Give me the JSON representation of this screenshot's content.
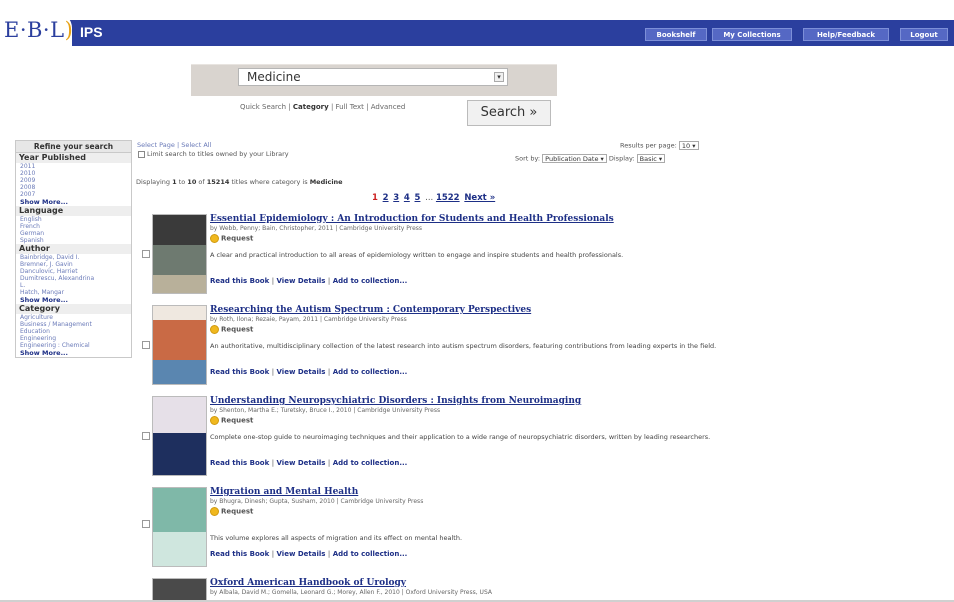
{
  "header": {
    "logo_text": "E·B·L",
    "product": "IPS",
    "nav": [
      {
        "label": "Bookshelf"
      },
      {
        "label": "My Collections"
      },
      {
        "label": "Help/Feedback"
      },
      {
        "label": "Logout"
      }
    ],
    "colors": {
      "bar": "#2b3f9e",
      "button": "#5568c4",
      "logo_accent": "#e8a317"
    }
  },
  "search": {
    "selected": "Medicine",
    "link_quick": "Quick Search",
    "link_category": "Category",
    "link_fulltext": "Full Text",
    "link_advanced": "Advanced",
    "sep": "|",
    "button": "Search »"
  },
  "sidebar": {
    "heading": "Refine your search",
    "year_title": "Year Published",
    "years": [
      "2011",
      "2010",
      "2009",
      "2008",
      "2007"
    ],
    "language_title": "Language",
    "languages": [
      "English",
      "French",
      "German",
      "Spanish"
    ],
    "author_title": "Author",
    "authors": [
      "Bainbridge, David I.",
      "Bremner, J. Gavin",
      "Danculovic, Harriet",
      "Dumitrescu, Alexandrina",
      "L.",
      "Hatch, Mangar"
    ],
    "category_title": "Category",
    "categories": [
      "Agriculture",
      "Business / Management",
      "Education",
      "Engineering",
      "Engineering : Chemical"
    ],
    "show_more": "Show More..."
  },
  "results": {
    "select_page": "Select Page",
    "select_all": "Select All",
    "limit_label": "Limit search to titles owned by your Library",
    "per_page_label": "Results per page:",
    "per_page": "10",
    "sort_label": "Sort by:",
    "sort_value": "Publication Date",
    "display_label": "Display:",
    "display_value": "Basic",
    "summary_prefix": "Displaying",
    "from": "1",
    "to": "10",
    "total": "15214",
    "summary_mid": "titles where category is",
    "category": "Medicine",
    "pager": {
      "current": "1",
      "pages": [
        "2",
        "3",
        "4",
        "5"
      ],
      "ellipsis": "...",
      "last": "1522",
      "next": "Next »"
    },
    "items": [
      {
        "title": "Essential Epidemiology : An Introduction for Students and Health Professionals",
        "meta": "by Webb, Penny; Bain, Christopher, 2011 | Cambridge University Press",
        "request": "Request",
        "desc": "A clear and practical introduction to all areas of epidemiology written to engage and inspire students and health professionals.",
        "actions": [
          "Read this Book",
          "View Details",
          "Add to collection..."
        ]
      },
      {
        "title": "Researching the Autism Spectrum : Contemporary Perspectives",
        "meta": "by Roth, Ilona; Rezaie, Payam, 2011 | Cambridge University Press",
        "request": "Request",
        "desc": "An authoritative, multidisciplinary collection of the latest research into autism spectrum disorders, featuring contributions from leading experts in the field.",
        "actions": [
          "Read this Book",
          "View Details",
          "Add to collection..."
        ]
      },
      {
        "title": "Understanding Neuropsychiatric Disorders : Insights from Neuroimaging",
        "meta": "by Shenton, Martha E.; Turetsky, Bruce I., 2010 | Cambridge University Press",
        "request": "Request",
        "desc": "Complete one-stop guide to neuroimaging techniques and their application to a wide range of neuropsychiatric disorders, written by leading researchers.",
        "actions": [
          "Read this Book",
          "View Details",
          "Add to collection..."
        ]
      },
      {
        "title": "Migration and Mental Health",
        "meta": "by Bhugra, Dinesh; Gupta, Susham, 2010 | Cambridge University Press",
        "request": "Request",
        "desc": "This volume explores all aspects of migration and its effect on mental health.",
        "actions": [
          "Read this Book",
          "View Details",
          "Add to collection..."
        ]
      },
      {
        "title": "Oxford American Handbook of Urology",
        "meta": "by Albala, David M.; Gomella, Leonard G.; Morey, Allen F., 2010 | Oxford University Press, USA",
        "request": "",
        "desc": "",
        "actions": []
      }
    ]
  }
}
